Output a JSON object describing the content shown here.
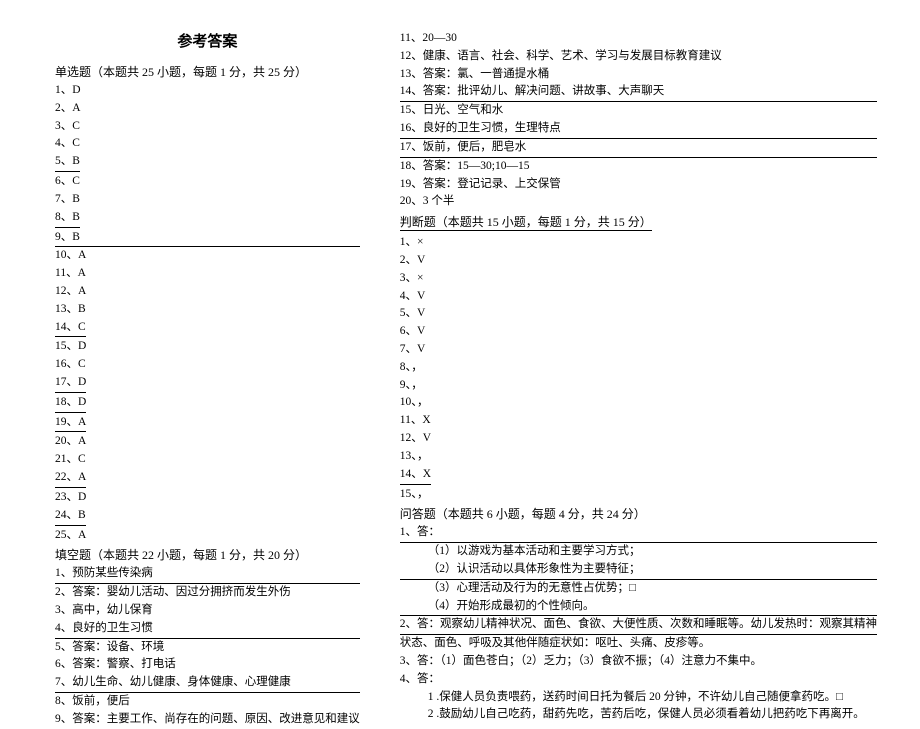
{
  "title": "参考答案",
  "left": {
    "section1_header": "单选题（本题共 25 小题，每题 1 分，共 25 分）",
    "items1": [
      {
        "text": "1、D",
        "u": false
      },
      {
        "text": "2、A",
        "u": false
      },
      {
        "text": "3、C",
        "u": false
      },
      {
        "text": "4、C",
        "u": false
      },
      {
        "text": "5、B",
        "u": true
      },
      {
        "text": "6、C",
        "u": false
      },
      {
        "text": "7、B",
        "u": false
      },
      {
        "text": "8、B",
        "u": true
      },
      {
        "text": "9、B",
        "u": true,
        "full": true
      },
      {
        "text": "10、A",
        "u": false
      },
      {
        "text": "11、A",
        "u": false
      },
      {
        "text": "12、A",
        "u": false
      },
      {
        "text": "13、B",
        "u": false
      },
      {
        "text": "14、C",
        "u": true
      },
      {
        "text": "15、D",
        "u": false
      },
      {
        "text": "16、C",
        "u": false
      },
      {
        "text": "17、D",
        "u": true
      },
      {
        "text": "18、D",
        "u": true
      },
      {
        "text": "19、A",
        "u": true
      },
      {
        "text": "20、A",
        "u": false
      },
      {
        "text": "21、C",
        "u": false
      },
      {
        "text": "22、A",
        "u": true
      },
      {
        "text": "23、D",
        "u": false
      },
      {
        "text": "24、B",
        "u": true
      },
      {
        "text": "25、A",
        "u": false
      }
    ],
    "section2_header": "填空题（本题共 22 小题，每题 1 分，共 20 分）",
    "items2": [
      {
        "text": "1、预防某些传染病",
        "u": true,
        "full": true
      },
      {
        "text": "2、答案：婴幼儿活动、因过分拥挤而发生外伤",
        "u": false
      },
      {
        "text": "3、高中，幼儿保育",
        "u": false
      },
      {
        "text": "4、良好的卫生习惯",
        "u": true,
        "full": true
      },
      {
        "text": "5、答案：设备、环境",
        "u": false
      },
      {
        "text": "6、答案：警察、打电话",
        "u": false
      },
      {
        "text": "7、幼儿生命、幼儿健康、身体健康、心理健康",
        "u": true,
        "full": true
      },
      {
        "text": "8、饭前，便后",
        "u": false
      },
      {
        "text": "9、答案：主要工作、尚存在的问题、原因、改进意见和建议",
        "u": false
      }
    ]
  },
  "right": {
    "items1": [
      {
        "text": "11、20—30",
        "u": false
      },
      {
        "text": "12、健康、语言、社会、科学、艺术、学习与发展目标教育建议",
        "u": false
      },
      {
        "text": "13、答案：氯、一普通提水桶",
        "u": false
      },
      {
        "text": "14、答案：批评幼儿、解决问题、讲故事、大声聊天",
        "u": true,
        "full": true
      },
      {
        "text": "15、日光、空气和水",
        "u": false
      },
      {
        "text": "16、良好的卫生习惯，生理特点",
        "u": true,
        "full": true
      },
      {
        "text": "17、饭前，便后，肥皂水",
        "u": true,
        "full": true
      },
      {
        "text": "18、答案：15—30;10—15",
        "u": false
      },
      {
        "text": "19、答案：登记记录、上交保管",
        "u": false
      },
      {
        "text": "20、3 个半",
        "u": false
      }
    ],
    "section3_header": "判断题（本题共 15 小题，每题 1 分，共 15 分）",
    "section3_u": true,
    "items2": [
      {
        "text": "1、×",
        "u": false
      },
      {
        "text": "2、V",
        "u": false
      },
      {
        "text": "3、×",
        "u": false
      },
      {
        "text": "4、V",
        "u": false
      },
      {
        "text": "5、V",
        "u": false
      },
      {
        "text": "6、V",
        "u": false
      },
      {
        "text": "7、V",
        "u": false
      },
      {
        "text": "8、，",
        "u": false
      },
      {
        "text": "9、，",
        "u": false
      },
      {
        "text": "10、，",
        "u": false
      },
      {
        "text": "11、X",
        "u": false
      },
      {
        "text": "12、V",
        "u": false
      },
      {
        "text": "13、，",
        "u": false
      },
      {
        "text": "14、X",
        "u": true
      },
      {
        "text": "15、，",
        "u": false
      }
    ],
    "section4_header": "问答题（本题共 6 小题，每题 4 分，共 24 分）",
    "items3": [
      {
        "text": "1、答：",
        "u": true,
        "full": true
      },
      {
        "text": "（1）以游戏为基本活动和主要学习方式；",
        "u": false,
        "indent": true
      },
      {
        "text": "（2）认识活动以具体形象性为主要特征；",
        "u": false,
        "indent": true,
        "ufull": true
      },
      {
        "text": "（3）心理活动及行为的无意性占优势；",
        "u": false,
        "indent": true,
        "trail": "□"
      },
      {
        "text": "（4）开始形成最初的个性倾向。",
        "u": false,
        "indent": true,
        "ufull": true
      },
      {
        "text": "2、答：观察幼儿精神状况、面色、食欲、大便性质、次数和睡眠等。幼儿发热时：观察其精神",
        "u": true,
        "full": true
      },
      {
        "text": "状态、面色、呼吸及其他伴随症状如：呕吐、头痛、皮疹等。",
        "u": false
      },
      {
        "text": "3、答：（1）面色苍白；（2）乏力；（3）食欲不振；（4）注意力不集中。",
        "u": false
      },
      {
        "text": "4、答：",
        "u": false
      },
      {
        "text": "1 .保健人员负责喂药，送药时间日托为餐后 20 分钟，不许幼儿自己随便拿药吃。",
        "u": false,
        "indent": true,
        "trail": "□"
      },
      {
        "text": "2 .鼓励幼儿自己吃药，甜药先吃，苦药后吃，保健人员必须看着幼儿把药吃下再离开。",
        "u": false,
        "indent": true
      }
    ]
  }
}
